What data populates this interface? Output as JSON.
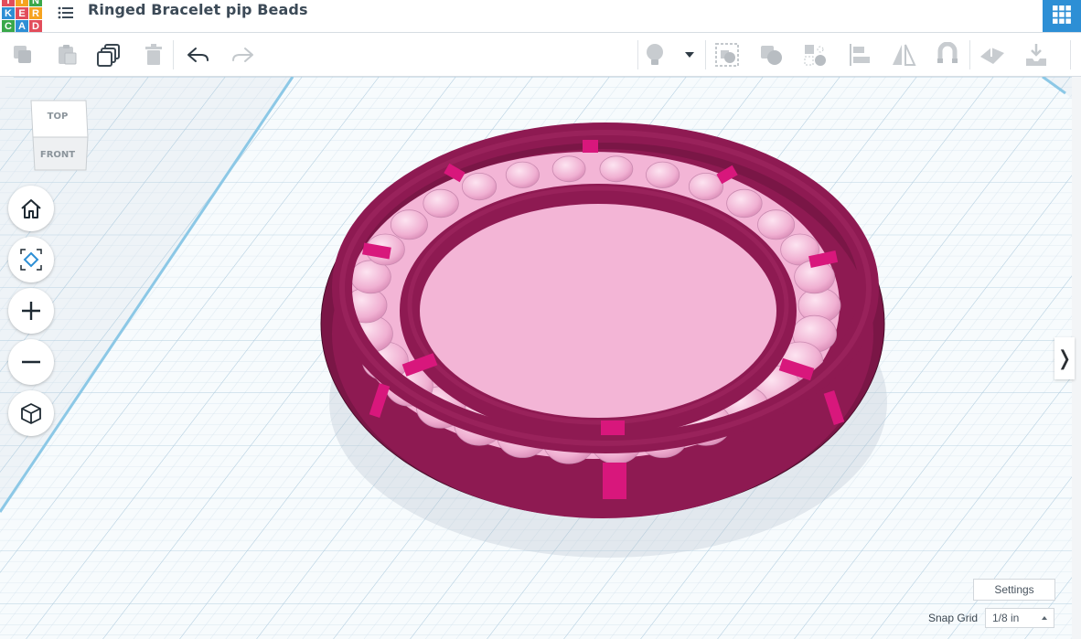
{
  "app": {
    "logo_letters": [
      "T",
      "I",
      "N",
      "K",
      "E",
      "R",
      "C",
      "A",
      "D"
    ],
    "logo_colors": [
      "#e24d5b",
      "#f6a31f",
      "#3aa84a",
      "#2d8fd5",
      "#e24d5b",
      "#f6a31f",
      "#3aa84a",
      "#2d8fd5",
      "#e24d5b"
    ],
    "document_title": "Ringed Bracelet pip Beads"
  },
  "toolbar": {
    "left_tools": [
      "copy-icon",
      "paste-icon",
      "duplicate-icon",
      "delete-icon",
      "undo-icon",
      "redo-icon"
    ],
    "right_tools": [
      "lightbulb-icon",
      "dropdown-icon",
      "group-icon",
      "ungroup-icon",
      "hole-icon",
      "align-icon",
      "mirror-icon",
      "magnet-icon",
      "workplane-icon",
      "export-icon"
    ]
  },
  "viewcube": {
    "top_label": "TOP",
    "front_label": "FRONT"
  },
  "nav_controls": [
    "home-view",
    "fit-all",
    "zoom-in",
    "zoom-out",
    "perspective"
  ],
  "footer": {
    "settings_label": "Settings",
    "snap_grid_label": "Snap Grid",
    "snap_grid_value": "1/8 in"
  },
  "colors": {
    "accent": "#2d8fd5",
    "ring": "#8e1a52",
    "bead": "#f3b5d6",
    "connector": "#d8177c",
    "grid_minor": "#cfe0eb",
    "grid_major": "#a9c8dc"
  }
}
